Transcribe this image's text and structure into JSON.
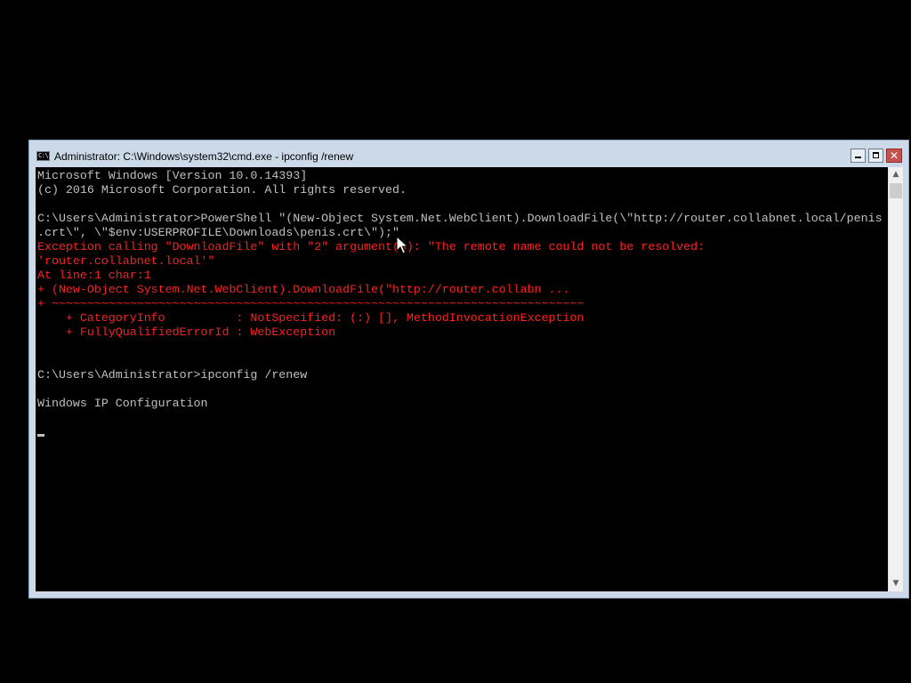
{
  "window": {
    "title": "Administrator: C:\\Windows\\system32\\cmd.exe - ipconfig  /renew",
    "icon": "cmd-icon",
    "icon_text": "C:\\",
    "controls": {
      "minimize": "minimize-icon",
      "maximize": "maximize-icon",
      "close": "close-icon",
      "close_glyph": "✕"
    }
  },
  "console": {
    "lines": [
      {
        "text": "Microsoft Windows [Version 10.0.14393]",
        "color": "white"
      },
      {
        "text": "(c) 2016 Microsoft Corporation. All rights reserved.",
        "color": "white"
      },
      {
        "text": "",
        "color": "white"
      },
      {
        "text": "C:\\Users\\Administrator>PowerShell \"(New-Object System.Net.WebClient).DownloadFile(\\\"http://router.collabnet.local/penis",
        "color": "white"
      },
      {
        "text": ".crt\\\", \\\"$env:USERPROFILE\\Downloads\\penis.crt\\\");\"",
        "color": "white"
      },
      {
        "text": "Exception calling \"DownloadFile\" with \"2\" argument(s): \"The remote name could not be resolved:",
        "color": "red"
      },
      {
        "text": "'router.collabnet.local'\"",
        "color": "red"
      },
      {
        "text": "At line:1 char:1",
        "color": "red"
      },
      {
        "text": "+ (New-Object System.Net.WebClient).DownloadFile(\"http://router.collabn ...",
        "color": "red"
      },
      {
        "text": "+ ~~~~~~~~~~~~~~~~~~~~~~~~~~~~~~~~~~~~~~~~~~~~~~~~~~~~~~~~~~~~~~~~~~~~~~~~~~~",
        "color": "red"
      },
      {
        "text": "    + CategoryInfo          : NotSpecified: (:) [], MethodInvocationException",
        "color": "red"
      },
      {
        "text": "    + FullyQualifiedErrorId : WebException",
        "color": "red"
      },
      {
        "text": "",
        "color": "white"
      },
      {
        "text": "",
        "color": "white"
      },
      {
        "text": "C:\\Users\\Administrator>ipconfig /renew",
        "color": "white"
      },
      {
        "text": "",
        "color": "white"
      },
      {
        "text": "Windows IP Configuration",
        "color": "white"
      }
    ],
    "colors": {
      "background": "#000000",
      "white": "#c0c0c0",
      "red": "#ff2020"
    }
  },
  "scrollbar": {
    "up_icon": "scroll-up-arrow-icon",
    "down_icon": "scroll-down-arrow-icon",
    "up_glyph": "▲",
    "down_glyph": "▼"
  },
  "pointer": "mouse-pointer-icon"
}
